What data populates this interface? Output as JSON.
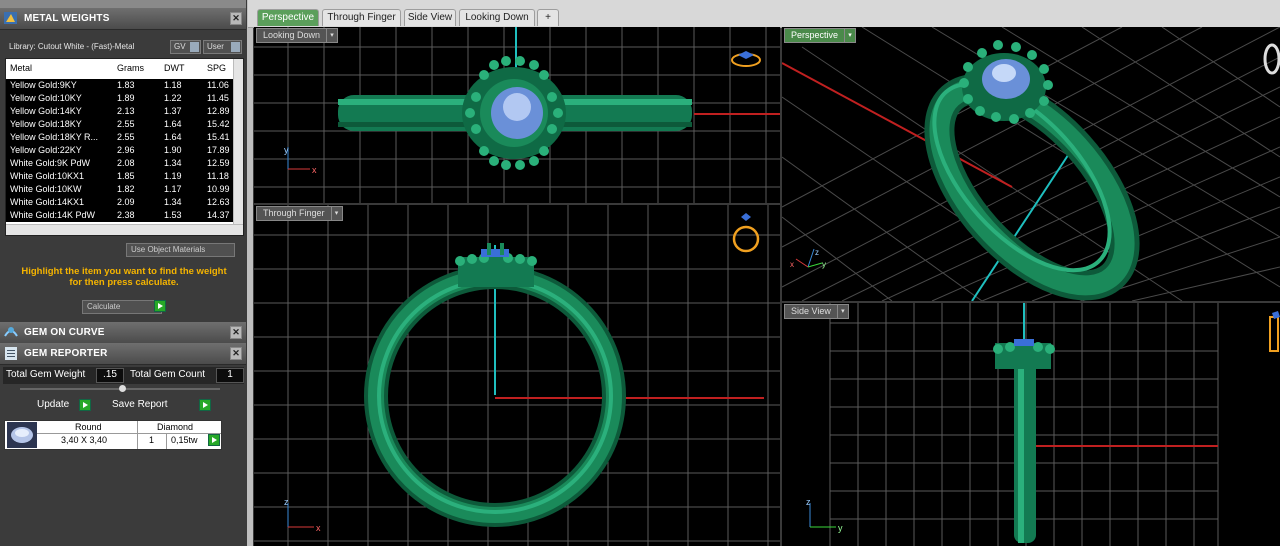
{
  "metal_panel": {
    "title": "METAL WEIGHTS",
    "library": "Library: Cutout White - (Fast)-Metal",
    "gv_label": "GV",
    "user_label": "User",
    "headers": [
      "Metal",
      "Grams",
      "DWT",
      "SPG"
    ],
    "rows": [
      [
        "Yellow Gold:9KY",
        "1.83",
        "1.18",
        "11.06"
      ],
      [
        "Yellow Gold:10KY",
        "1.89",
        "1.22",
        "11.45"
      ],
      [
        "Yellow Gold:14KY",
        "2.13",
        "1.37",
        "12.89"
      ],
      [
        "Yellow Gold:18KY",
        "2.55",
        "1.64",
        "15.42"
      ],
      [
        "Yellow Gold:18KY R...",
        "2.55",
        "1.64",
        "15.41"
      ],
      [
        "Yellow Gold:22KY",
        "2.96",
        "1.90",
        "17.89"
      ],
      [
        "White Gold:9K PdW",
        "2.08",
        "1.34",
        "12.59"
      ],
      [
        "White Gold:10KX1",
        "1.85",
        "1.19",
        "11.18"
      ],
      [
        "White Gold:10KW",
        "1.82",
        "1.17",
        "10.99"
      ],
      [
        "White Gold:14KX1",
        "2.09",
        "1.34",
        "12.63"
      ],
      [
        "White Gold:14K PdW",
        "2.38",
        "1.53",
        "14.37"
      ]
    ],
    "use_object_materials": "Use Object Materials",
    "hint_line1": "Highlight the item you want to find the weight",
    "hint_line2": "for then press calculate.",
    "calculate": "Calculate"
  },
  "gem_curve": {
    "title": "GEM ON CURVE"
  },
  "gem_reporter": {
    "title": "GEM REPORTER",
    "total_weight_label": "Total Gem Weight",
    "total_weight_value": ".15",
    "total_count_label": "Total Gem Count",
    "total_count_value": "1",
    "update_label": "Update",
    "save_report_label": "Save Report",
    "gem": {
      "shape": "Round",
      "material": "Diamond",
      "size": "3,40 X 3,40",
      "count": "1",
      "weight": "0,15tw"
    }
  },
  "tabs": [
    "Perspective",
    "Through Finger",
    "Side View",
    "Looking Down"
  ],
  "add_tab": "+",
  "viewports": {
    "looking_down": "Looking Down",
    "perspective": "Perspective",
    "through_finger": "Through Finger",
    "side_view": "Side View"
  },
  "axis": {
    "x": "x",
    "y": "y",
    "z": "z"
  },
  "colors": {
    "ring": "#1a8a5a",
    "ring_dark": "#0f5a3a",
    "gem": "#7ea6e8",
    "grid": "#6e6e6e",
    "accent_tab": "#5b9f5b"
  }
}
